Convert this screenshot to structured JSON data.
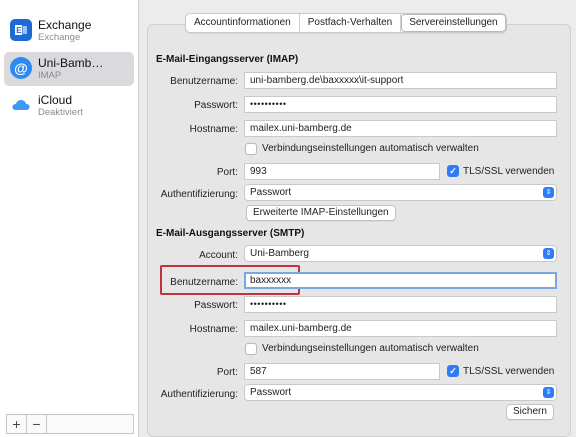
{
  "accounts": [
    {
      "name": "Exchange",
      "type": "Exchange",
      "icon": "exchange-icon"
    },
    {
      "name": "Uni-Bamb…",
      "type": "IMAP",
      "icon": "at-sign-icon"
    },
    {
      "name": "iCloud",
      "type": "Deaktiviert",
      "icon": "icloud-icon"
    }
  ],
  "sidebar_buttons": {
    "add": "+",
    "remove": "−"
  },
  "tabs": [
    "Accountinformationen",
    "Postfach-Verhalten",
    "Servereinstellungen"
  ],
  "active_tab": "Servereinstellungen",
  "imap": {
    "heading": "E-Mail-Eingangsserver (IMAP)",
    "username_label": "Benutzername:",
    "username": "uni-bamberg.de\\baxxxxx\\it-support",
    "password_label": "Passwort:",
    "password": "••••••••••",
    "hostname_label": "Hostname:",
    "hostname": "mailex.uni-bamberg.de",
    "auto_label": "Verbindungseinstellungen automatisch verwalten",
    "port_label": "Port:",
    "port": "993",
    "tls_label": "TLS/SSL verwenden",
    "auth_label": "Authentifizierung:",
    "auth": "Passwort",
    "advanced_button": "Erweiterte IMAP-Einstellungen"
  },
  "smtp": {
    "heading": "E-Mail-Ausgangsserver (SMTP)",
    "account_label": "Account:",
    "account": "Uni-Bamberg",
    "username_label": "Benutzername:",
    "username": "baxxxxxx",
    "password_label": "Passwort:",
    "password": "••••••••••",
    "hostname_label": "Hostname:",
    "hostname": "mailex.uni-bamberg.de",
    "auto_label": "Verbindungseinstellungen automatisch verwalten",
    "port_label": "Port:",
    "port": "587",
    "tls_label": "TLS/SSL verwenden",
    "auth_label": "Authentifizierung:",
    "auth": "Passwort"
  },
  "save_button": "Sichern",
  "colors": {
    "accent": "#2f7cf6",
    "highlight": "#c0343e",
    "selected_row": "#d9d9de"
  }
}
